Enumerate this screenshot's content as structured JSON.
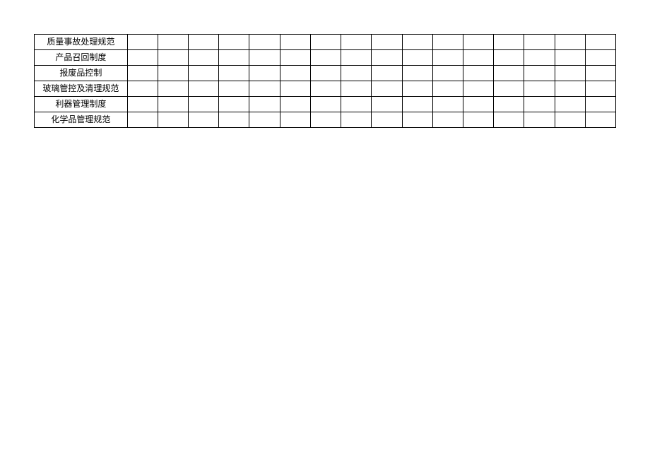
{
  "rows": [
    {
      "label": "质量事故处理规范"
    },
    {
      "label": "产品召回制度"
    },
    {
      "label": "报废品控制"
    },
    {
      "label": "玻璃管控及清理规范"
    },
    {
      "label": "利器管理制度"
    },
    {
      "label": "化学品管理规范"
    }
  ],
  "dataColumnCount": 16
}
